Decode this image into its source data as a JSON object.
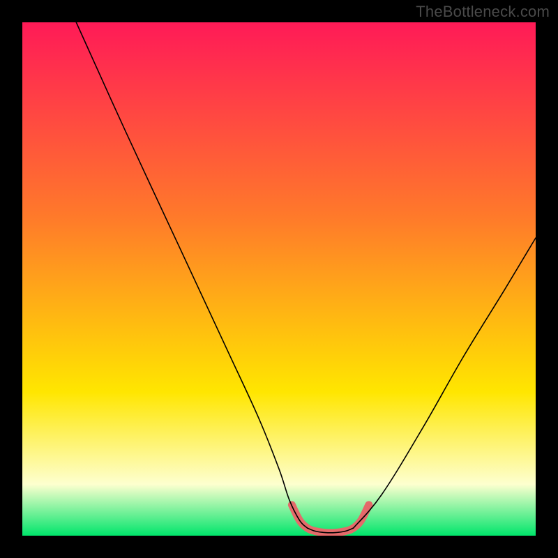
{
  "watermark": "TheBottleneck.com",
  "chart_data": {
    "type": "line",
    "title": "",
    "xlabel": "",
    "ylabel": "",
    "xlim": [
      0,
      100
    ],
    "ylim": [
      0,
      100
    ],
    "gradient_top": "#ff1a57",
    "gradient_mid1": "#ff7a2a",
    "gradient_mid2": "#ffe600",
    "gradient_band_pale": "#fdffcf",
    "gradient_bottom": "#00e56b",
    "series": [
      {
        "name": "left-curve",
        "x_norm": [
          10.5,
          20,
          30,
          40,
          46,
          50,
          52,
          54,
          55.5
        ],
        "y_norm": [
          100,
          79,
          57.5,
          36,
          23,
          13,
          7,
          3,
          1.5
        ]
      },
      {
        "name": "bottom-flat",
        "x_norm": [
          55.5,
          57,
          59,
          61,
          63,
          64.5
        ],
        "y_norm": [
          1.5,
          0.9,
          0.6,
          0.6,
          0.9,
          1.5
        ]
      },
      {
        "name": "right-curve",
        "x_norm": [
          64.5,
          70,
          78,
          86,
          94,
          100
        ],
        "y_norm": [
          1.5,
          8,
          21,
          35,
          48,
          58
        ]
      },
      {
        "name": "pink-highlight",
        "x_norm": [
          52.5,
          54,
          55.5,
          57,
          59,
          61,
          63,
          64.5,
          66,
          67.5
        ],
        "y_norm": [
          6,
          3,
          1.5,
          0.9,
          0.6,
          0.6,
          0.9,
          1.5,
          3,
          6
        ]
      }
    ]
  }
}
